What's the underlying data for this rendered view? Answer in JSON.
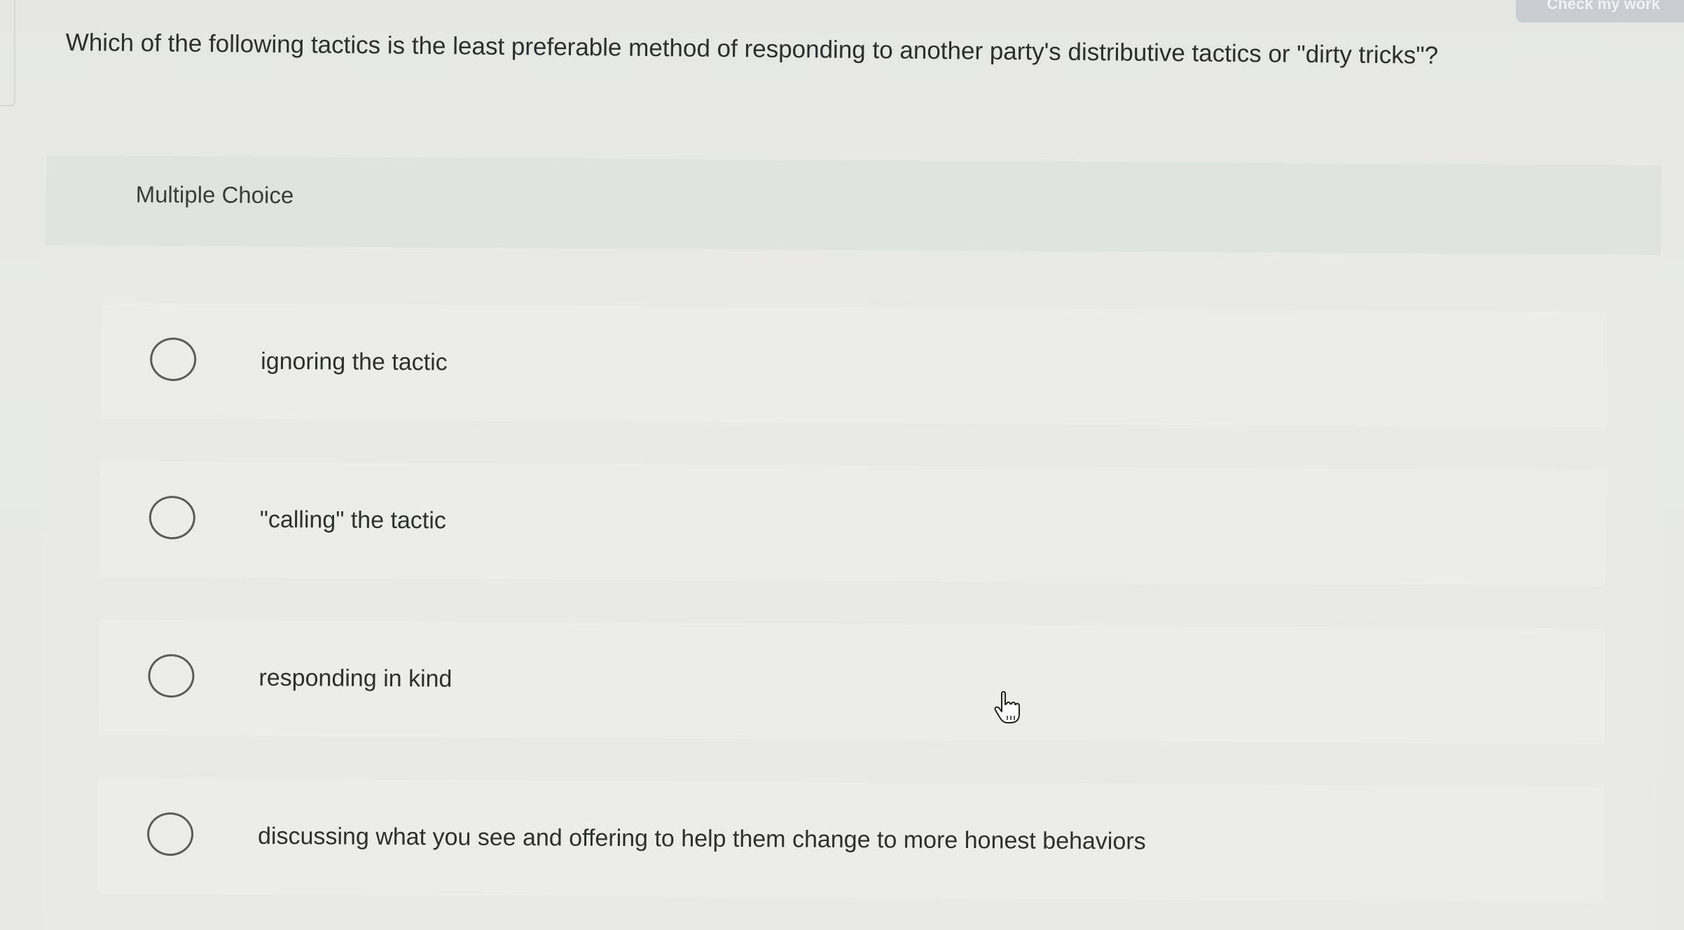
{
  "header": {
    "check_button_label": "Check my work"
  },
  "question": {
    "text": "Which of the following tactics is the least preferable method of responding to another party's distributive tactics or \"dirty tricks\"?"
  },
  "panel": {
    "title": "Multiple Choice",
    "options": [
      {
        "label": "ignoring the tactic"
      },
      {
        "label": "\"calling\" the tactic"
      },
      {
        "label": "responding in kind"
      },
      {
        "label": "discussing what you see and offering to help them change to more honest behaviors"
      }
    ]
  },
  "icons": {
    "radio": "radio-unselected-icon",
    "cursor": "hand-pointer-icon"
  },
  "colors": {
    "background": "#e7e8e5",
    "text": "#2e2f2f",
    "radio_border": "#5a5b5c"
  }
}
